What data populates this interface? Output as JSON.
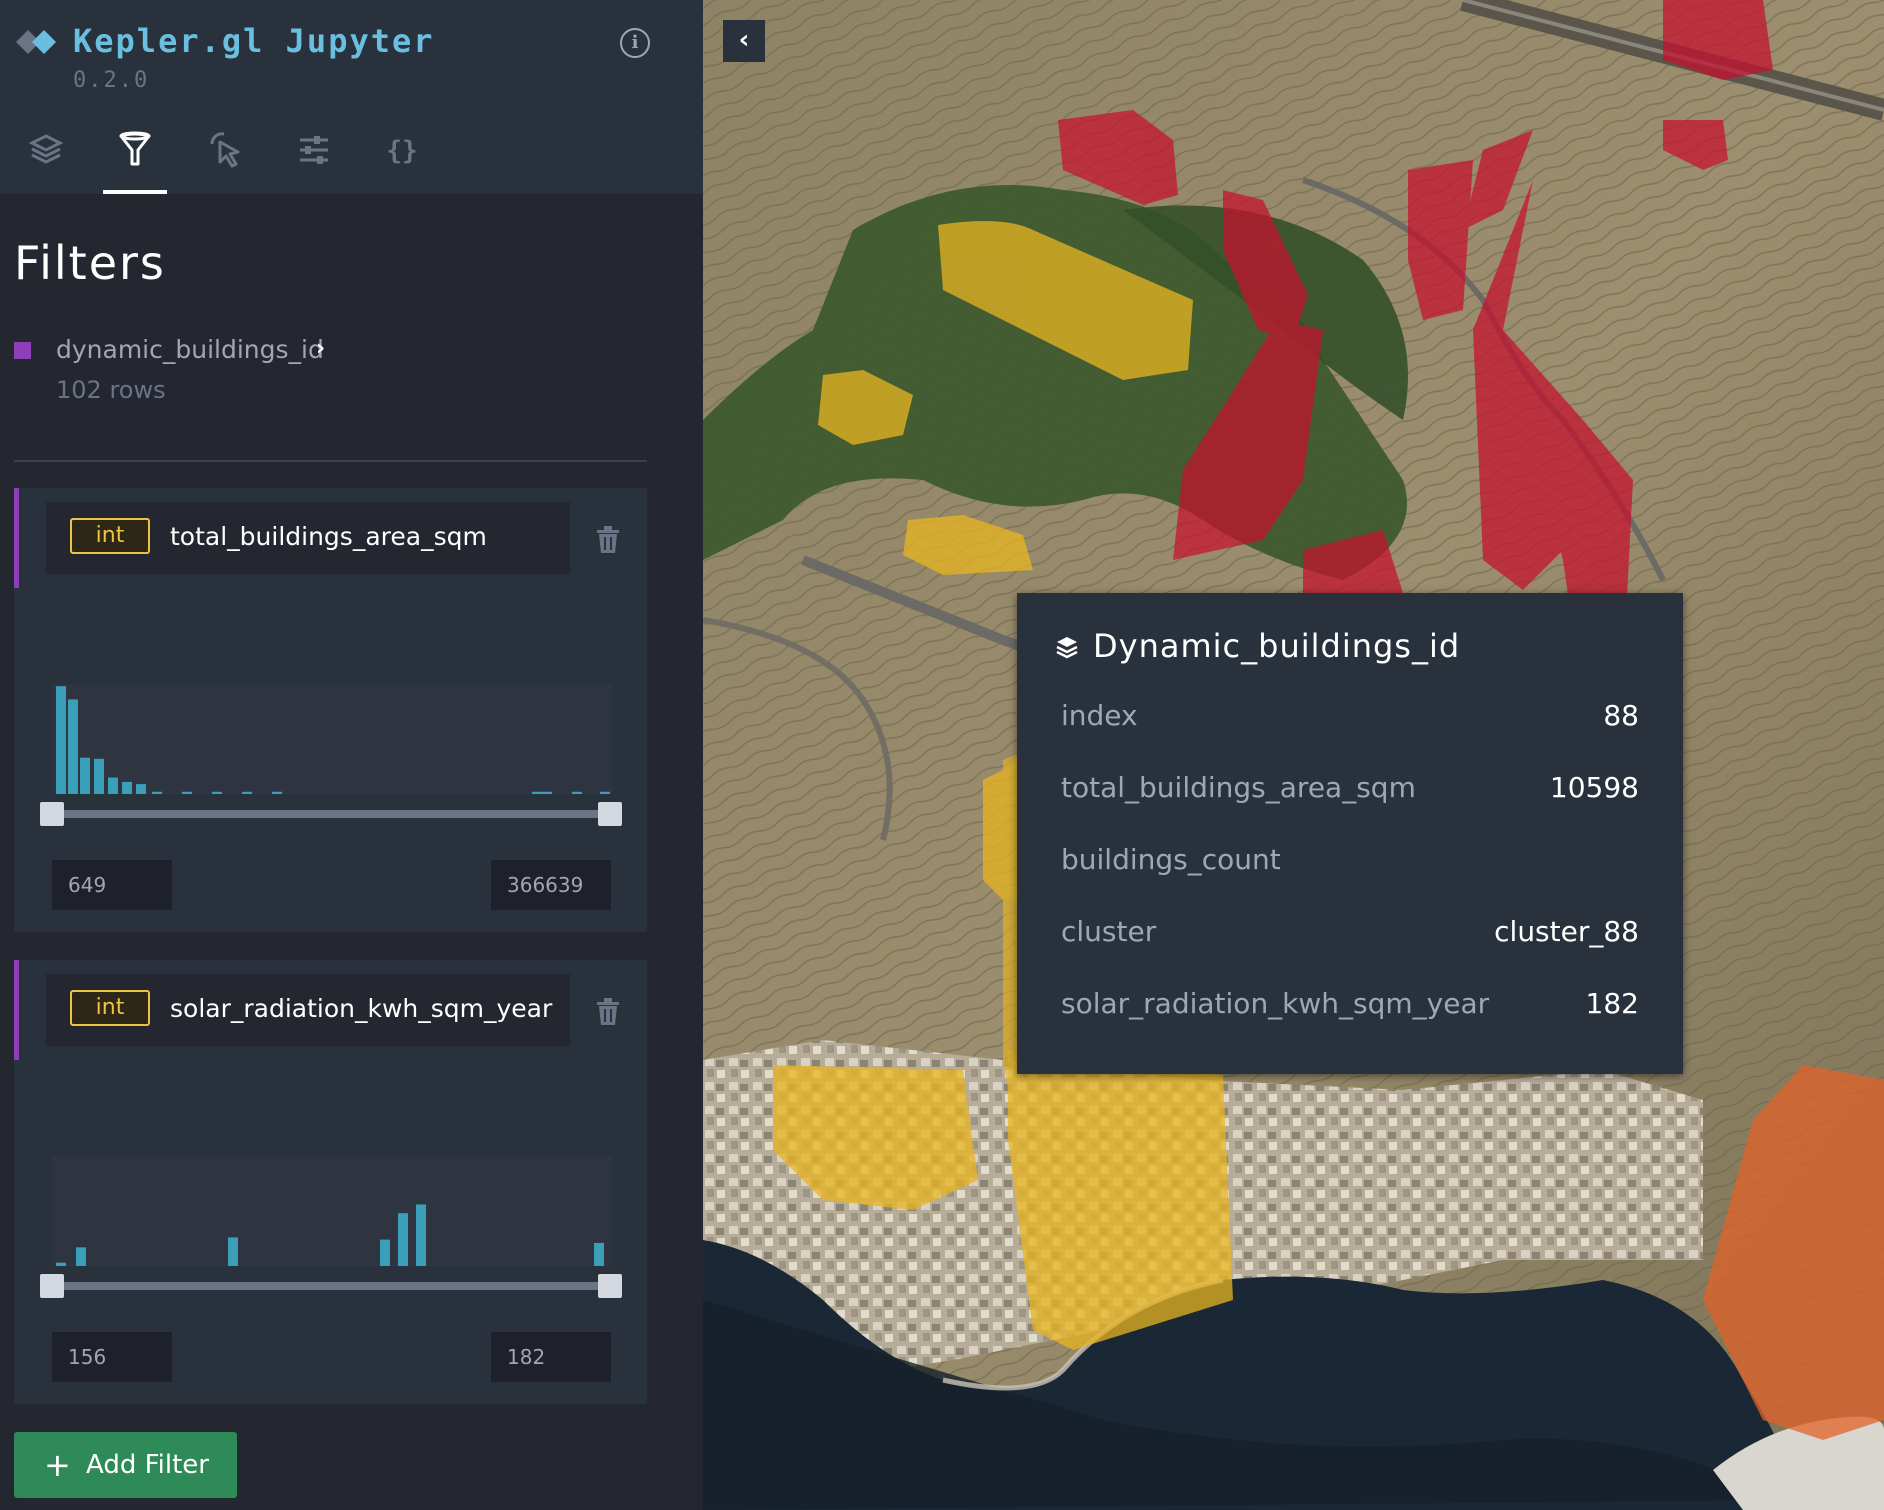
{
  "app": {
    "title": "Kepler.gl Jupyter",
    "version": "0.2.0",
    "accent_color": "#6ABEE0"
  },
  "nav_tabs": [
    {
      "icon": "layers-icon",
      "active": false
    },
    {
      "icon": "filter-icon",
      "active": true
    },
    {
      "icon": "interaction-icon",
      "active": false
    },
    {
      "icon": "map-settings-icon",
      "active": false
    },
    {
      "icon": "json-config-icon",
      "active": false
    }
  ],
  "panel": {
    "title": "Filters",
    "dataset": {
      "name": "dynamic_buildings_id",
      "rows": "102 rows",
      "color": "#8E3FB8"
    }
  },
  "filters": [
    {
      "type": "int",
      "field": "total_buildings_area_sqm",
      "min": "649",
      "max": "366639",
      "histogram": [
        0.98,
        0.86,
        0.33,
        0.32,
        0.15,
        0.11,
        0.09,
        0.02,
        0.02,
        0.02,
        0.02,
        0.02,
        0.02,
        0.02,
        0.02,
        0.02
      ]
    },
    {
      "type": "int",
      "field": "solar_radiation_kwh_sqm_year",
      "min": "156",
      "max": "182",
      "histogram": [
        0.03,
        0.17,
        0.26,
        0.24,
        0.48,
        0.56,
        0.21
      ]
    }
  ],
  "add_filter": {
    "label": "Add Filter",
    "color": "#2E8B57"
  },
  "tooltip": {
    "title": "Dynamic_buildings_id",
    "rows": [
      {
        "key": "index",
        "value": "88"
      },
      {
        "key": "total_buildings_area_sqm",
        "value": "10598"
      },
      {
        "key": "buildings_count",
        "value": ""
      },
      {
        "key": "cluster",
        "value": "cluster_88"
      },
      {
        "key": "solar_radiation_kwh_sqm_year",
        "value": "182"
      }
    ]
  },
  "map": {
    "colors": {
      "low": "#E8B520",
      "high": "#C8102E",
      "mid": "#E0632A"
    }
  }
}
